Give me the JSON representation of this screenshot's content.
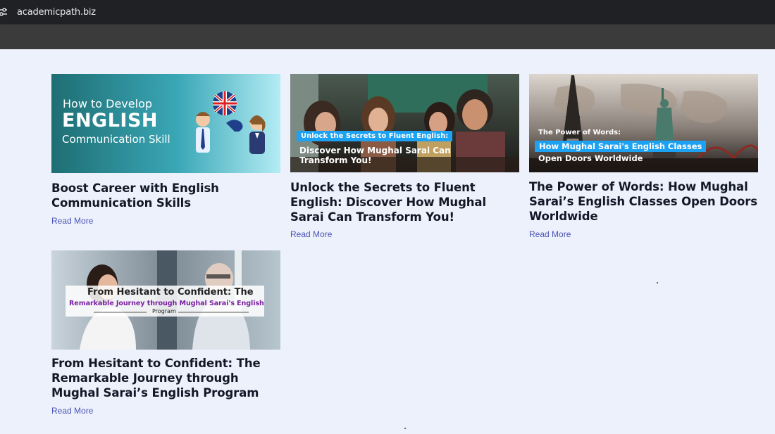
{
  "browser": {
    "url": "academicpath.biz",
    "site_info_icon": "tune-icon"
  },
  "posts": [
    {
      "title": "Boost Career with English Communication Skills",
      "read_more": "Read More",
      "thumbnail": {
        "line1": "How to Develop",
        "line2": "ENGLISH",
        "line3": "Communication Skill",
        "colors": {
          "bg_start": "#1e6e73",
          "bg_end": "#b3ecf4"
        }
      }
    },
    {
      "title": "Unlock the Secrets to Fluent English: Discover How Mughal Sarai Can Transform You!",
      "read_more": "Read More",
      "thumbnail": {
        "tag": "Unlock the Secrets to Fluent English:",
        "caption": "Discover How Mughal Sarai Can Transform You!",
        "colors": {
          "tag_bg": "#1da1f2"
        }
      }
    },
    {
      "title": "The Power of Words: How Mughal Sarai’s English Classes Open Doors Worldwide",
      "read_more": "Read More",
      "thumbnail": {
        "line1": "The Power of Words:",
        "highlight": "How Mughal Sarai's English Classes",
        "line3": "Open Doors Worldwide",
        "colors": {
          "highlight_bg": "#1da1f2"
        }
      }
    },
    {
      "title": "From Hesitant to Confident: The Remarkable Journey through Mughal Sarai’s English Program",
      "read_more": "Read More",
      "thumbnail": {
        "line1": "From Hesitant to Confident: The",
        "line2": "Remarkable Journey through Mughal Sarai's English",
        "line3": "Program",
        "colors": {
          "accent": "#7b1fa2"
        }
      }
    }
  ],
  "theme": {
    "page_bg": "#edf1fb",
    "title_color": "#111827",
    "link_color": "#4a53b8"
  }
}
